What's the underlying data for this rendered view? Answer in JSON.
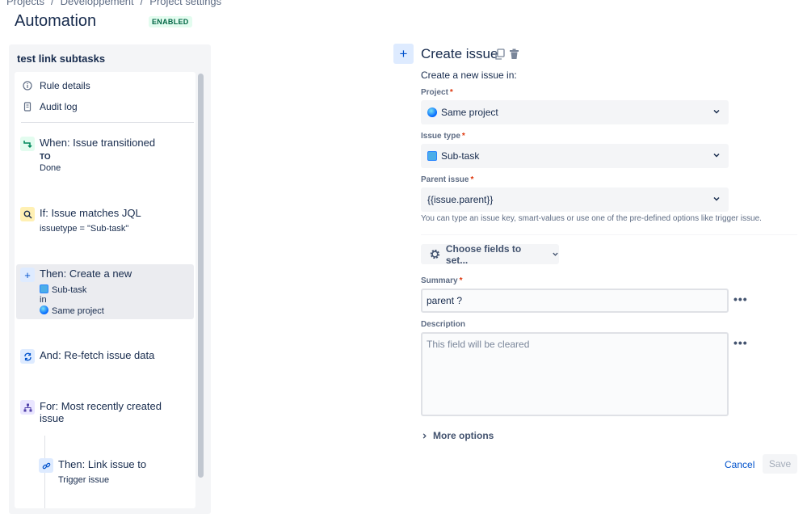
{
  "breadcrumb": {
    "items": [
      "Projects",
      "Developpement",
      "Project settings"
    ]
  },
  "page": {
    "title": "Automation",
    "status": "ENABLED"
  },
  "rule": {
    "name": "test link subtasks",
    "menu": [
      {
        "label": "Rule details",
        "icon": "info-icon"
      },
      {
        "label": "Audit log",
        "icon": "document-icon"
      }
    ],
    "steps": {
      "trigger": {
        "title": "When: Issue transitioned",
        "line1": "TO",
        "line2": "Done"
      },
      "condition": {
        "title": "If: Issue matches JQL",
        "line1": "issuetype = \"Sub-task\""
      },
      "action": {
        "title": "Then: Create a new",
        "issue_type": "Sub-task",
        "in": "in",
        "project": "Same project"
      },
      "refetch": {
        "title": "And: Re-fetch issue data"
      },
      "branch": {
        "title": "For: Most recently created issue"
      },
      "link": {
        "title": "Then: Link issue to",
        "line1": "Trigger issue"
      }
    }
  },
  "editor": {
    "title": "Create issue",
    "intro": "Create a new issue in:",
    "project": {
      "label": "Project",
      "value": "Same project"
    },
    "issue_type": {
      "label": "Issue type",
      "value": "Sub-task"
    },
    "parent": {
      "label": "Parent issue",
      "value": "{{issue.parent}}"
    },
    "helper": "You can type an issue key, smart-values or use one of the pre-defined options like trigger issue.",
    "choose_fields": "Choose fields to set...",
    "summary": {
      "label": "Summary",
      "value": "parent ?"
    },
    "description": {
      "label": "Description",
      "placeholder": "This field will be cleared"
    },
    "more_options": "More options",
    "cancel": "Cancel",
    "save": "Save"
  },
  "colors": {
    "accent": "#0052cc",
    "required": "#de350b",
    "enabled_bg": "#e3fcef"
  }
}
